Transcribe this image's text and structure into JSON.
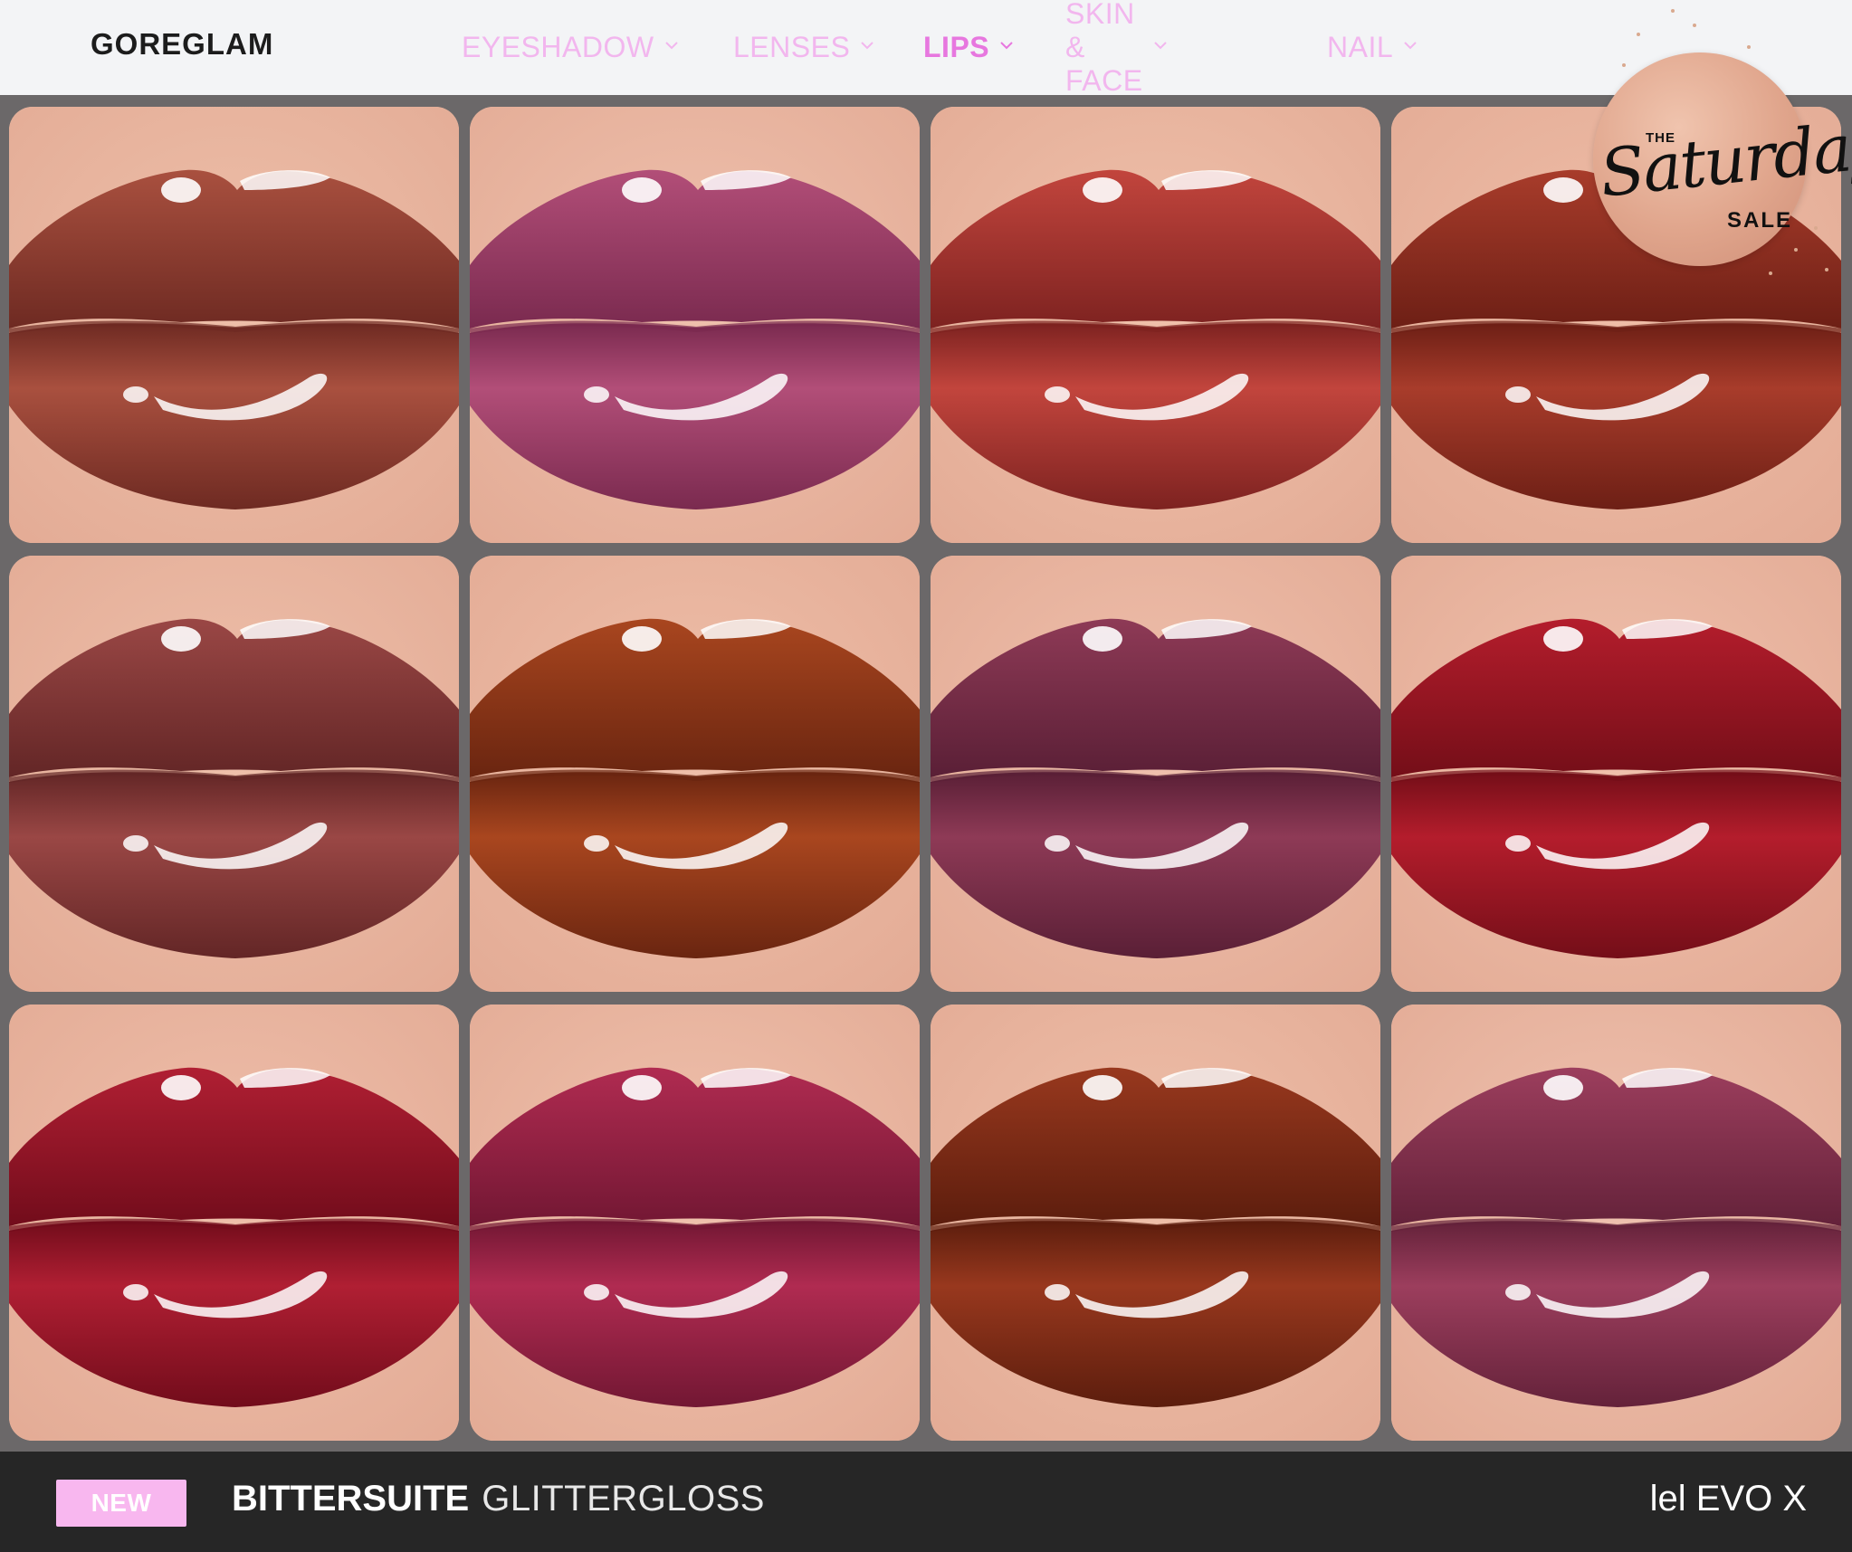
{
  "header": {
    "brand": "GOREGLAM",
    "nav": [
      {
        "label": "EYESHADOW",
        "active": false
      },
      {
        "label": "LENSES",
        "active": false
      },
      {
        "label": "LIPS",
        "active": true
      },
      {
        "label": "SKIN & FACE",
        "active": false
      },
      {
        "label": "NAIL",
        "active": false
      }
    ]
  },
  "sale_badge": {
    "the": "THE",
    "script": "Saturday",
    "sale": "SALE"
  },
  "swatches": [
    {
      "lip": "#a9503f",
      "deep": "#6e2a22",
      "skin": "#eec0aa"
    },
    {
      "lip": "#b24e78",
      "deep": "#7a2a4f",
      "skin": "#efc1ae"
    },
    {
      "lip": "#c2453d",
      "deep": "#7d2220",
      "skin": "#f0c2ac"
    },
    {
      "lip": "#a83c2b",
      "deep": "#6d1f15",
      "skin": "#efbea8"
    },
    {
      "lip": "#9a4745",
      "deep": "#632626",
      "skin": "#eec0ab"
    },
    {
      "lip": "#a9461f",
      "deep": "#6a2510",
      "skin": "#efbfa9"
    },
    {
      "lip": "#8e3a56",
      "deep": "#5a1f36",
      "skin": "#efc0ad"
    },
    {
      "lip": "#b41d2c",
      "deep": "#740e18",
      "skin": "#f0c1ad"
    },
    {
      "lip": "#b01f33",
      "deep": "#720c1b",
      "skin": "#efbfab"
    },
    {
      "lip": "#b02b51",
      "deep": "#721733",
      "skin": "#f0c2ae"
    },
    {
      "lip": "#98381e",
      "deep": "#5c1d0d",
      "skin": "#efc0aa"
    },
    {
      "lip": "#9c3e5d",
      "deep": "#64223a",
      "skin": "#efc2b0"
    }
  ],
  "footer": {
    "new_label": "NEW",
    "product_name": "BITTERSUITE",
    "product_type": "GLITTERGLOSS",
    "compatibility": "lel EVO X"
  },
  "colors": {
    "nav_inactive": "#f2b6ee",
    "nav_active": "#e777df",
    "footer_bg": "#262626",
    "new_badge": "#f8b7ef"
  }
}
